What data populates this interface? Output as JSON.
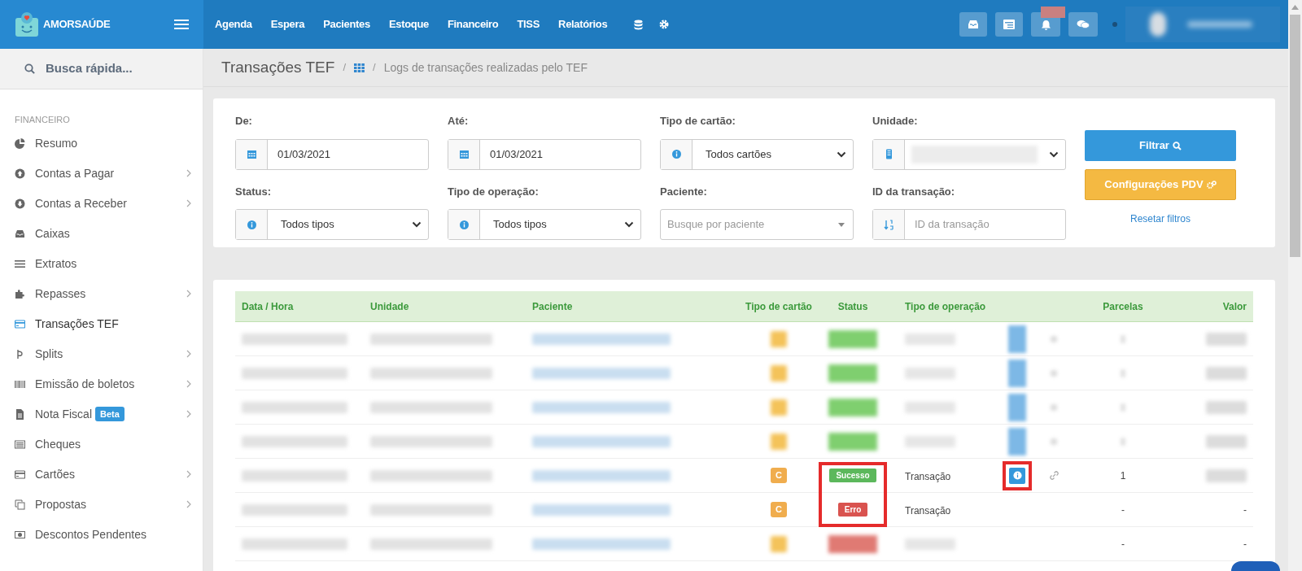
{
  "brand": {
    "name": "AMORSAÚDE"
  },
  "top_nav": [
    "Agenda",
    "Espera",
    "Pacientes",
    "Estoque",
    "Financeiro",
    "TISS",
    "Relatórios"
  ],
  "sidebar": {
    "search_placeholder": "Busca rápida...",
    "section": "FINANCEIRO",
    "items": [
      {
        "label": "Resumo",
        "submenu": false,
        "selected": false
      },
      {
        "label": "Contas a Pagar",
        "submenu": true,
        "selected": false
      },
      {
        "label": "Contas a Receber",
        "submenu": true,
        "selected": false
      },
      {
        "label": "Caixas",
        "submenu": false,
        "selected": false
      },
      {
        "label": "Extratos",
        "submenu": false,
        "selected": false
      },
      {
        "label": "Repasses",
        "submenu": true,
        "selected": false
      },
      {
        "label": "Transações TEF",
        "submenu": false,
        "selected": true
      },
      {
        "label": "Splits",
        "submenu": true,
        "selected": false
      },
      {
        "label": "Emissão de boletos",
        "submenu": true,
        "selected": false
      },
      {
        "label": "Nota Fiscal",
        "submenu": true,
        "selected": false,
        "badge": "Beta"
      },
      {
        "label": "Cheques",
        "submenu": false,
        "selected": false
      },
      {
        "label": "Cartões",
        "submenu": true,
        "selected": false
      },
      {
        "label": "Propostas",
        "submenu": true,
        "selected": false
      },
      {
        "label": "Descontos Pendentes",
        "submenu": false,
        "selected": false
      }
    ]
  },
  "breadcrumb": {
    "title": "Transações TEF",
    "separator_1": "/",
    "separator_2": "/",
    "subtitle": "Logs de transações realizadas pelo TEF"
  },
  "filters": [
    {
      "label": "De:",
      "kind": "date",
      "value": "01/03/2021"
    },
    {
      "label": "Até:",
      "kind": "date",
      "value": "01/03/2021"
    },
    {
      "label": "Tipo de cartão:",
      "kind": "select",
      "value": "Todos cartões"
    },
    {
      "label": "Unidade:",
      "kind": "unit"
    },
    {
      "label": "Status:",
      "kind": "select",
      "value": "Todos tipos"
    },
    {
      "label": "Tipo de operação:",
      "kind": "select",
      "value": "Todos tipos"
    },
    {
      "label": "Paciente:",
      "kind": "search",
      "placeholder": "Busque por paciente"
    },
    {
      "label": "ID da transação:",
      "kind": "id",
      "placeholder": "ID da transação"
    }
  ],
  "buttons": {
    "filter": "Filtrar",
    "config": "Configurações PDV",
    "reset": "Resetar filtros"
  },
  "table": {
    "columns": [
      "Data / Hora",
      "Unidade",
      "Paciente",
      "Tipo de cartão",
      "Status",
      "Tipo de operação",
      "Parcelas",
      "Valor"
    ],
    "rows": [
      {
        "card": {
          "blurred": true
        },
        "status": {
          "kind": "success",
          "blurred": true
        },
        "operation": {
          "blurred": true
        },
        "info_button": {
          "blurred": true
        },
        "link": {
          "blurred": true
        },
        "parcelas": {
          "blurred": true
        },
        "valor": {
          "blurred": true
        },
        "status_highlighted": false,
        "info_highlighted": false
      },
      {
        "card": {
          "blurred": true
        },
        "status": {
          "kind": "success",
          "blurred": true
        },
        "operation": {
          "blurred": true
        },
        "info_button": {
          "blurred": true
        },
        "link": {
          "blurred": true
        },
        "parcelas": {
          "blurred": true
        },
        "valor": {
          "blurred": true
        },
        "status_highlighted": false,
        "info_highlighted": false
      },
      {
        "card": {
          "blurred": true
        },
        "status": {
          "kind": "success",
          "blurred": true
        },
        "operation": {
          "blurred": true
        },
        "info_button": {
          "blurred": true
        },
        "link": {
          "blurred": true
        },
        "parcelas": {
          "blurred": true
        },
        "valor": {
          "blurred": true
        },
        "status_highlighted": false,
        "info_highlighted": false
      },
      {
        "card": {
          "blurred": true
        },
        "status": {
          "kind": "success",
          "blurred": true
        },
        "operation": {
          "blurred": true
        },
        "info_button": {
          "blurred": true
        },
        "link": {
          "blurred": true
        },
        "parcelas": {
          "blurred": true
        },
        "valor": {
          "blurred": true
        },
        "status_highlighted": false,
        "info_highlighted": false
      },
      {
        "card": {
          "blurred": false,
          "text": "C"
        },
        "status": {
          "kind": "success",
          "blurred": false,
          "text": "Sucesso"
        },
        "operation": {
          "blurred": false,
          "text": "Transação"
        },
        "info_button": {
          "blurred": false
        },
        "link": {
          "blurred": false
        },
        "parcelas": {
          "blurred": false,
          "text": "1"
        },
        "valor": {
          "blurred": true
        },
        "status_highlighted": true,
        "info_highlighted": true
      },
      {
        "card": {
          "blurred": false,
          "text": "C"
        },
        "status": {
          "kind": "error",
          "blurred": false,
          "text": "Erro"
        },
        "operation": {
          "blurred": false,
          "text": "Transação"
        },
        "parcelas": {
          "blurred": false,
          "text": "-"
        },
        "valor": {
          "blurred": false,
          "text": "-"
        },
        "status_highlighted": true,
        "info_highlighted": false
      },
      {
        "card": {
          "blurred": true
        },
        "status": {
          "kind": "error",
          "blurred": true
        },
        "operation": {
          "blurred": true
        },
        "parcelas": {
          "blurred": false,
          "text": "-"
        },
        "valor": {
          "blurred": false,
          "text": "-"
        },
        "status_highlighted": false,
        "info_highlighted": false
      }
    ]
  }
}
